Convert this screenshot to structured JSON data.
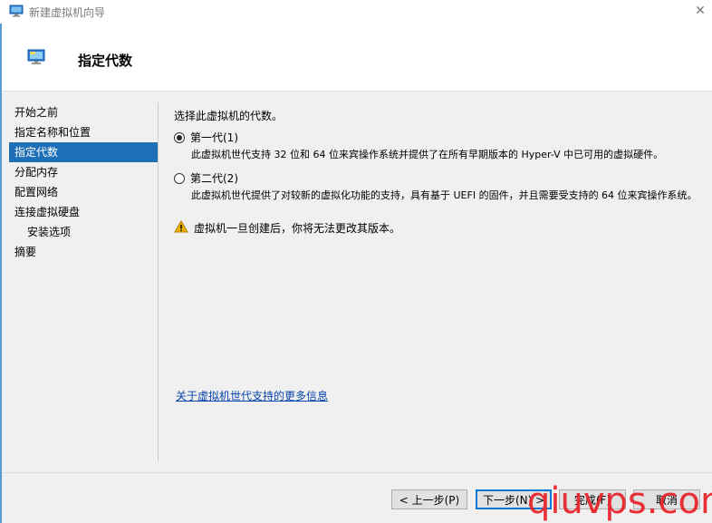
{
  "window": {
    "title": "新建虚拟机向导",
    "close_glyph": "✕"
  },
  "header": {
    "page_title": "指定代数"
  },
  "nav": {
    "items": [
      {
        "label": "开始之前"
      },
      {
        "label": "指定名称和位置"
      },
      {
        "label": "指定代数"
      },
      {
        "label": "分配内存"
      },
      {
        "label": "配置网络"
      },
      {
        "label": "连接虚拟硬盘"
      },
      {
        "label": "安装选项"
      },
      {
        "label": "摘要"
      }
    ],
    "active_index": 2
  },
  "main": {
    "prompt": "选择此虚拟机的代数。",
    "gen1": {
      "label": "第一代(1)",
      "selected": true,
      "description": "此虚拟机世代支持 32 位和 64 位来宾操作系统并提供了在所有早期版本的 Hyper-V 中已可用的虚拟硬件。"
    },
    "gen2": {
      "label": "第二代(2)",
      "selected": false,
      "description": "此虚拟机世代提供了对较新的虚拟化功能的支持，具有基于 UEFI 的固件，并且需要受支持的 64 位来宾操作系统。"
    },
    "warning": "虚拟机一旦创建后，你将无法更改其版本。",
    "more_info_link": "关于虚拟机世代支持的更多信息"
  },
  "footer": {
    "back_label": "< 上一步(P)",
    "next_label": "下一步(N) >",
    "finish_label": "完成(F)",
    "cancel_label": "取消"
  },
  "watermark": "qiuvps.com",
  "colors": {
    "accent": "#1e6fb8",
    "link": "#0645ad",
    "primary_border": "#0078d7",
    "warning": "#f0b400",
    "watermark": "#e8262d"
  },
  "icons": {
    "app": "hyperv-monitor-icon",
    "header": "hyperv-monitor-icon",
    "warning": "warning-triangle-icon",
    "close": "close-icon"
  }
}
